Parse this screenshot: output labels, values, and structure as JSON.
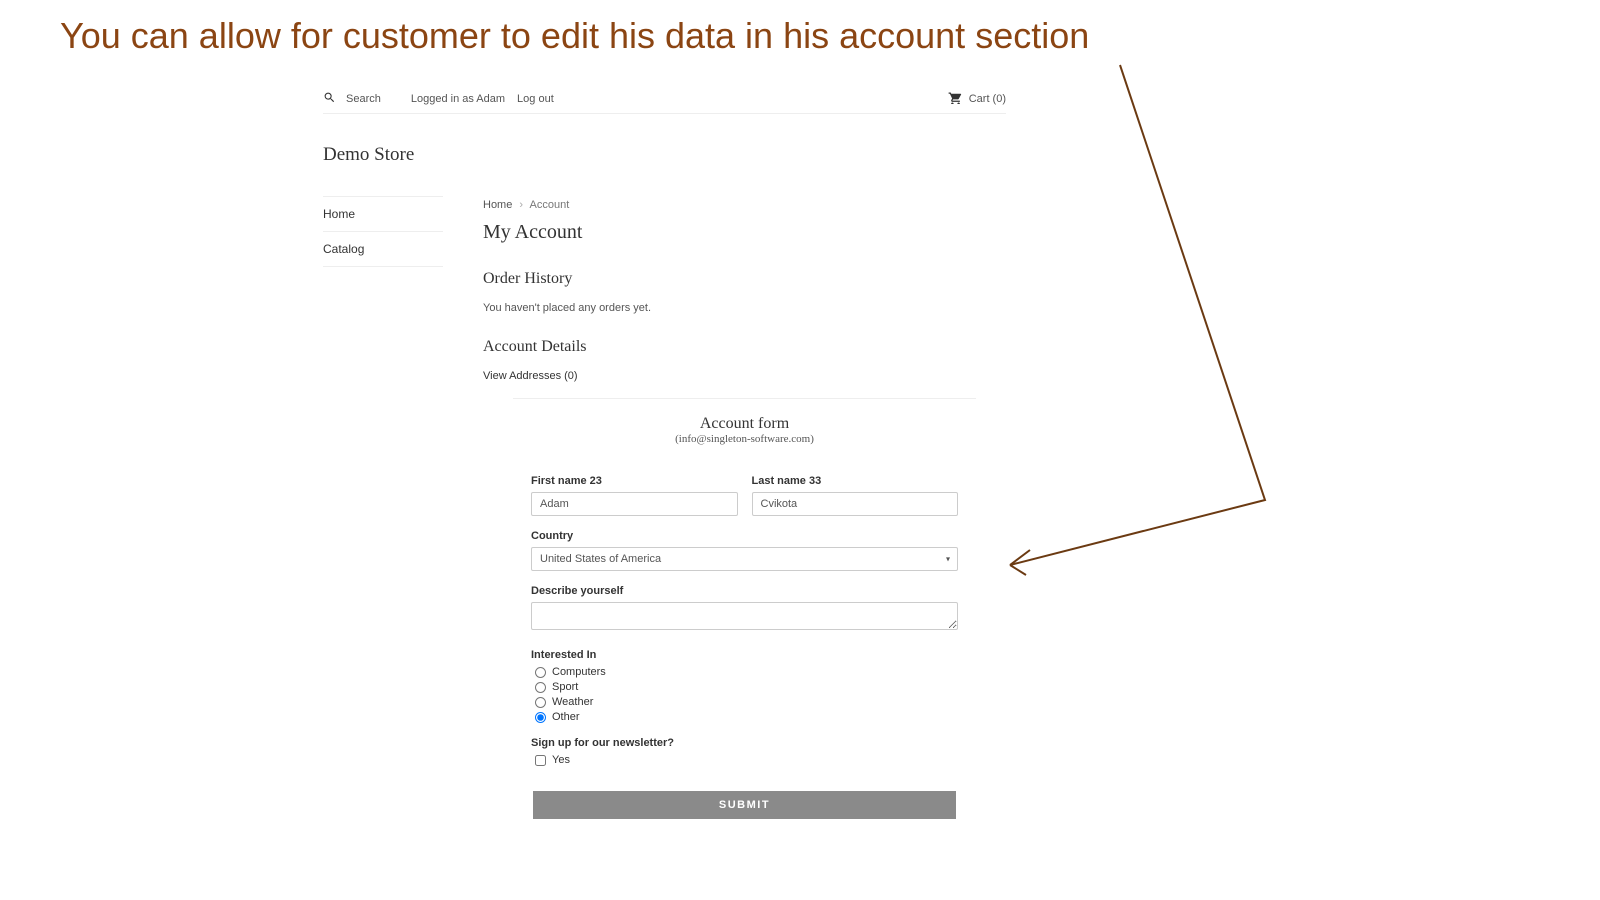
{
  "annotation": "You can allow for customer to edit his data in his account section",
  "topbar": {
    "search_label": "Search",
    "logged_in_text": "Logged in as Adam",
    "logout_label": "Log out",
    "cart_label": "Cart (0)"
  },
  "store": {
    "title": "Demo Store",
    "nav": [
      {
        "label": "Home"
      },
      {
        "label": "Catalog"
      }
    ]
  },
  "breadcrumb": {
    "home": "Home",
    "current": "Account"
  },
  "page": {
    "title": "My Account",
    "order_history_title": "Order History",
    "order_history_empty": "You haven't placed any orders yet.",
    "account_details_title": "Account Details",
    "view_addresses_label": "View Addresses (0)"
  },
  "form": {
    "title": "Account form",
    "subtitle": "(info@singleton-software.com)",
    "first_name_label": "First name 23",
    "first_name_value": "Adam",
    "last_name_label": "Last name 33",
    "last_name_value": "Cvikota",
    "country_label": "Country",
    "country_value": "United States of America",
    "describe_label": "Describe yourself",
    "describe_value": "",
    "interested_label": "Interested In",
    "interests": [
      {
        "label": "Computers",
        "checked": false
      },
      {
        "label": "Sport",
        "checked": false
      },
      {
        "label": "Weather",
        "checked": false
      },
      {
        "label": "Other",
        "checked": true
      }
    ],
    "newsletter_label": "Sign up for our newsletter?",
    "newsletter_option": "Yes",
    "submit_label": "SUBMIT"
  }
}
